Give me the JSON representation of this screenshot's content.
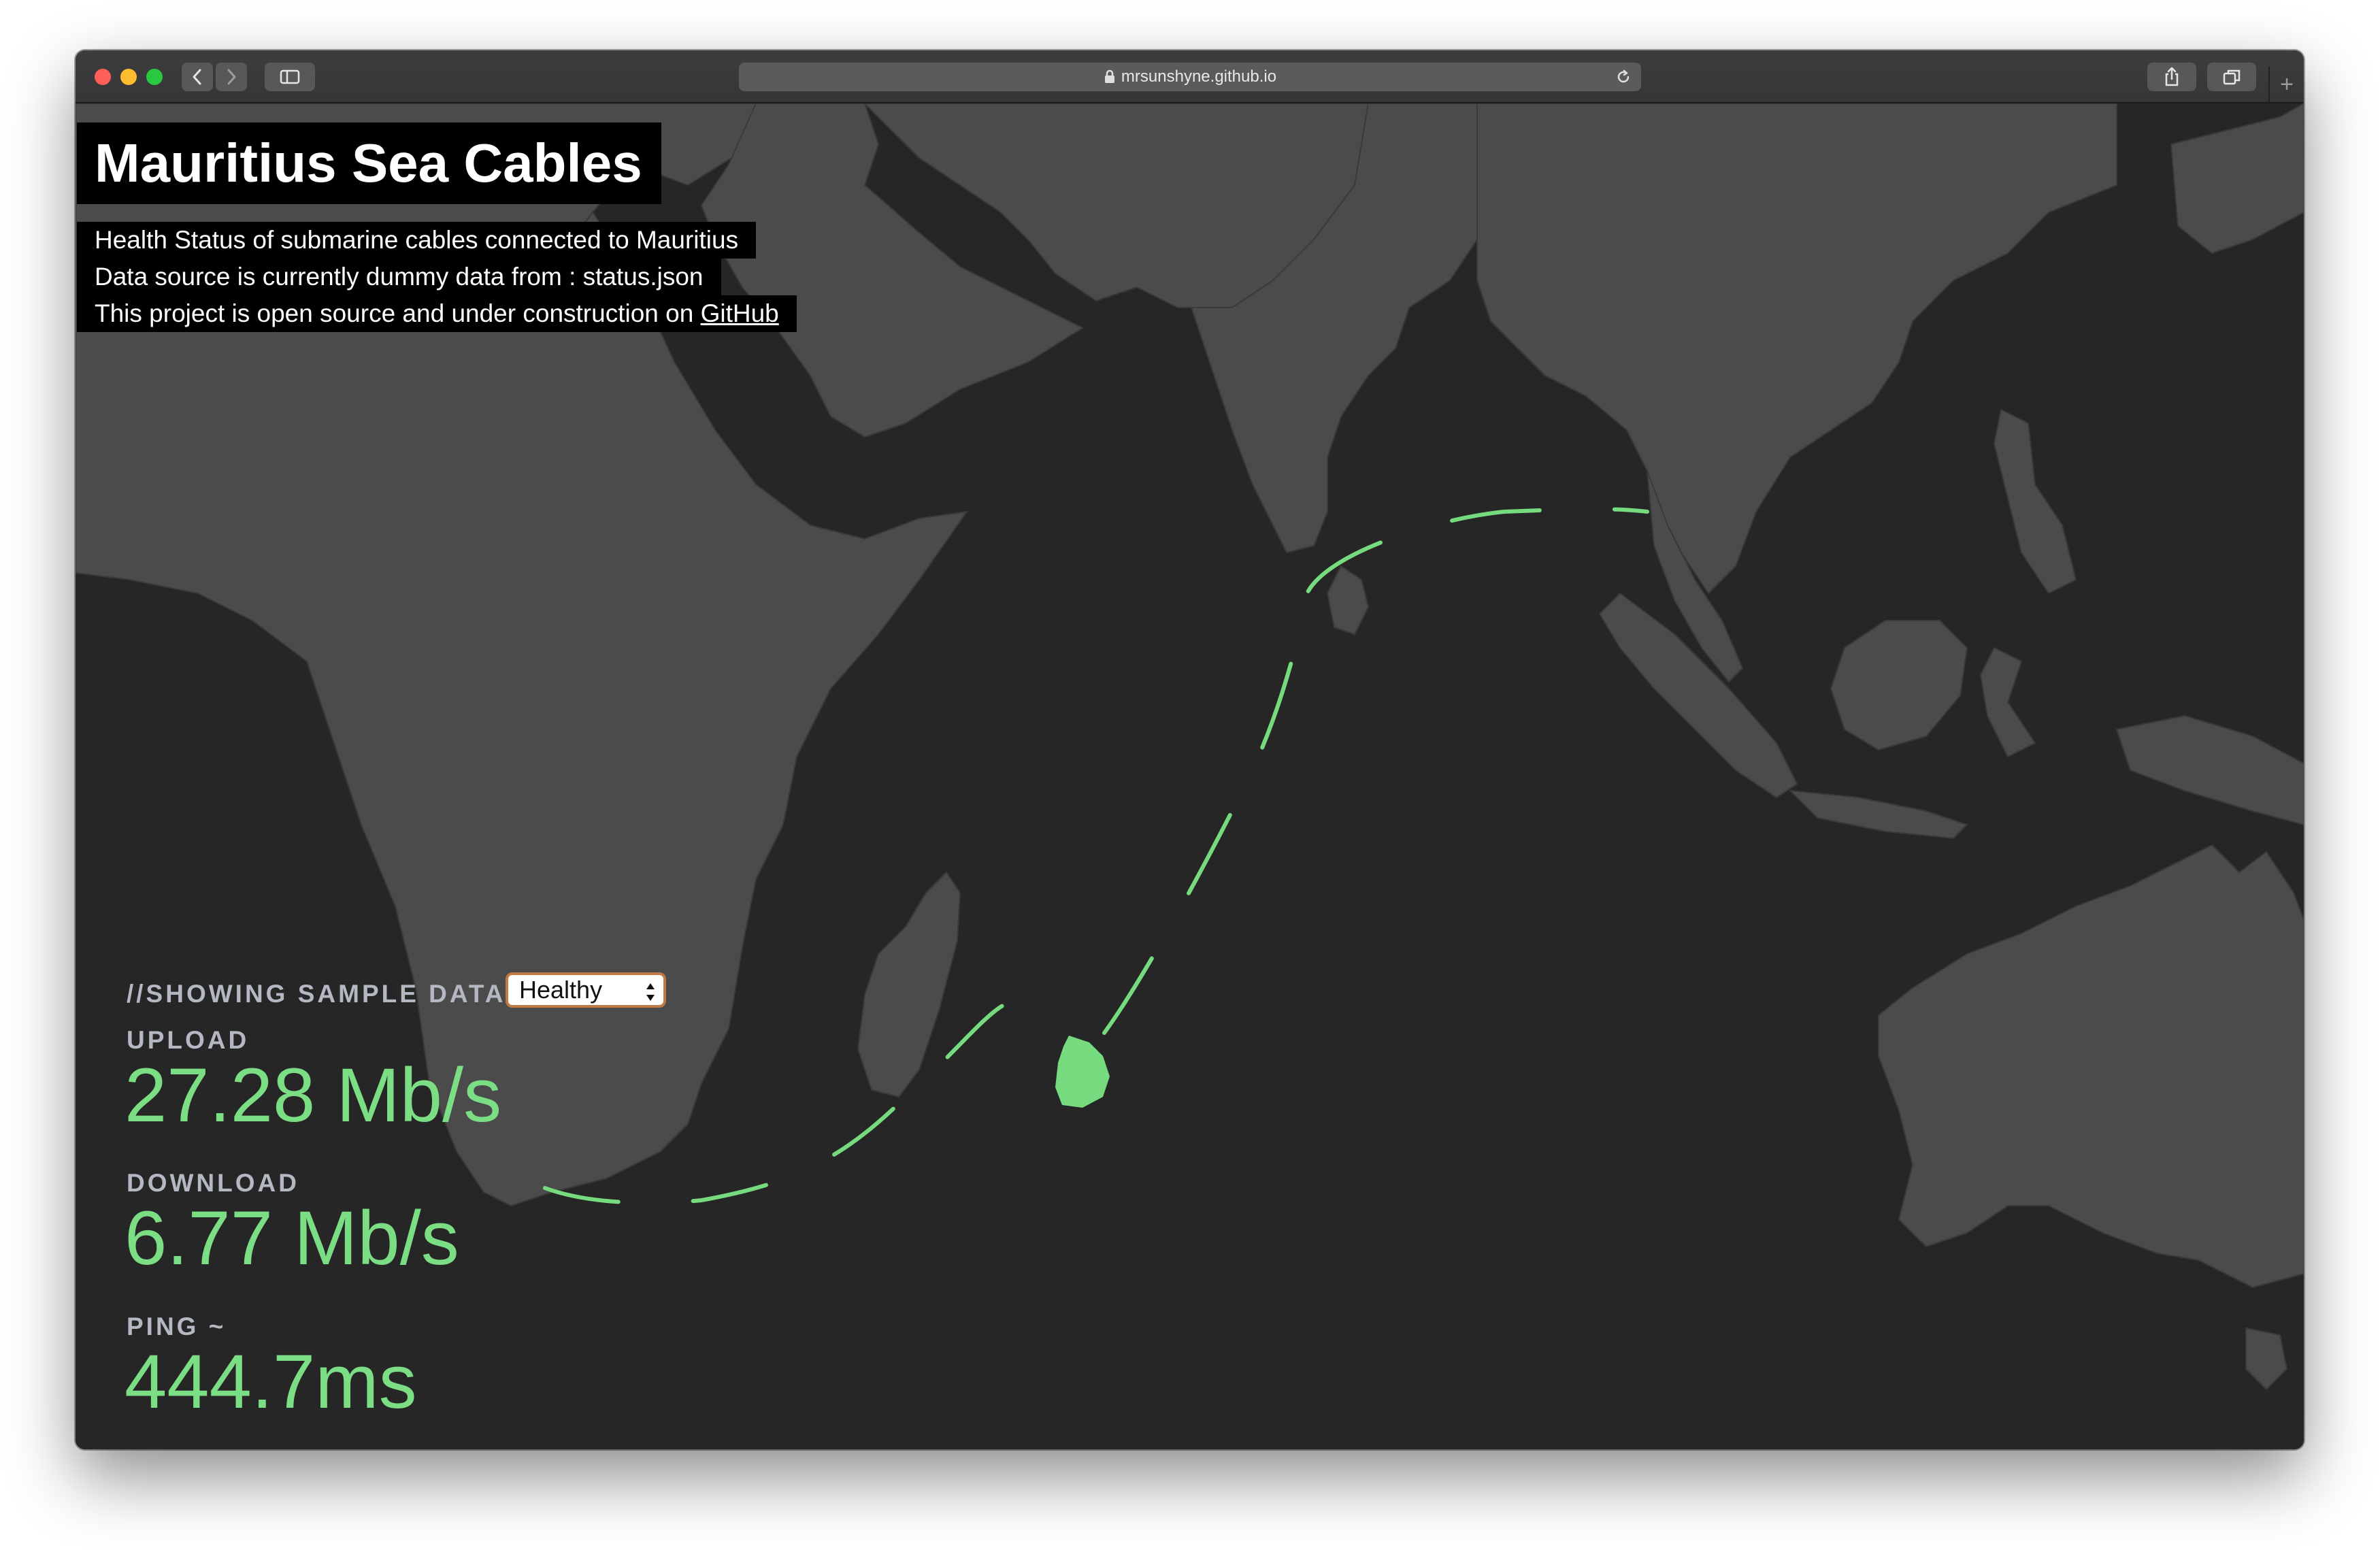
{
  "browser": {
    "url": "mrsunshyne.github.io",
    "icons": [
      "close-dot",
      "minimize-dot",
      "zoom-dot",
      "back-icon",
      "forward-icon",
      "sidebar-icon",
      "lock-icon",
      "reload-icon",
      "share-icon",
      "tabs-icon",
      "new-tab-icon"
    ]
  },
  "page": {
    "title": "Mauritius Sea Cables",
    "info": {
      "line1": "Health Status of submarine cables connected to Mauritius",
      "line2": "Data source is currently dummy data from : status.json",
      "line3_prefix": "This project is open source and under construction on ",
      "line3_link": "GitHub"
    }
  },
  "stats": {
    "sample_label": "//SHOWING SAMPLE DATA",
    "status_select": {
      "selected": "Healthy"
    },
    "upload_label": "UPLOAD",
    "upload_value": "27.28 Mb/s",
    "download_label": "DOWNLOAD",
    "download_value": "6.77 Mb/s",
    "ping_label": "PING ~",
    "ping_value": "444.7ms"
  },
  "colors": {
    "ocean": "#262626",
    "land": "#4b4b4b",
    "cable": "#76db7e",
    "stat_value": "#7bdd84",
    "stat_label": "#b4b8c2"
  }
}
